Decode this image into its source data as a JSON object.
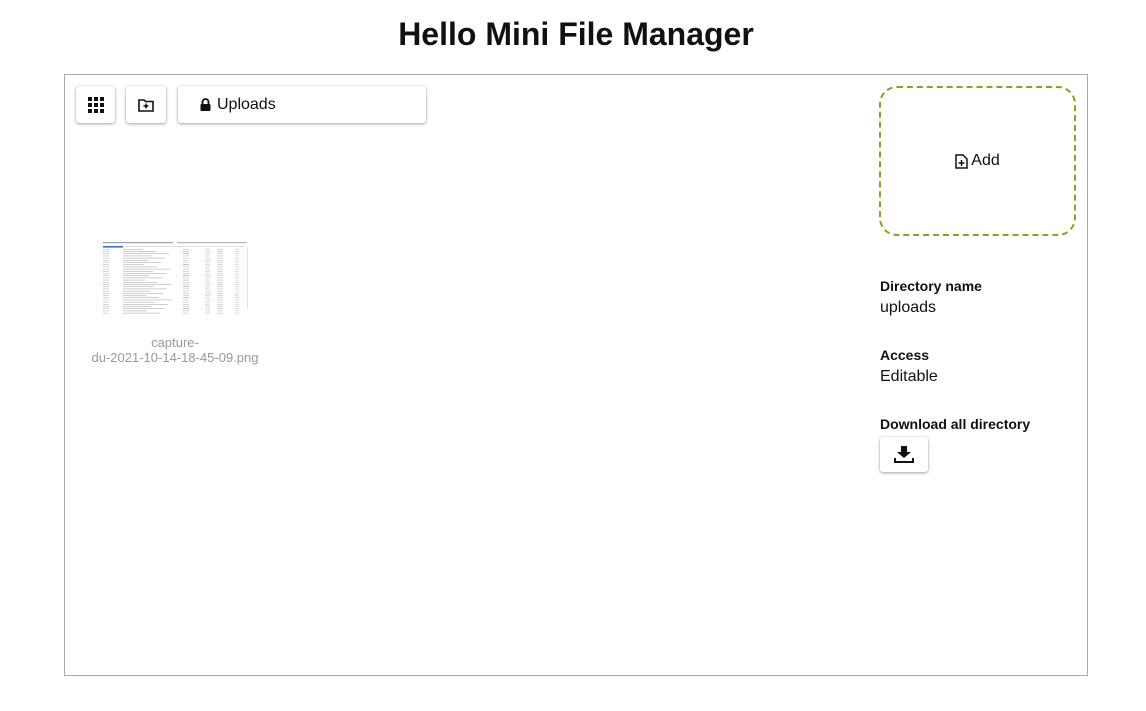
{
  "page": {
    "title": "Hello Mini File Manager"
  },
  "toolbar": {
    "grid_icon": "grid-view-icon",
    "new_folder_icon": "folder-plus-icon",
    "current_dir_label": "Uploads",
    "lock_icon": "lock-icon"
  },
  "files": [
    {
      "name": "capture-\ndu-2021-10-14-18-45-09.png",
      "name_line1": "capture-",
      "name_line2": "du-2021-10-14-18-45-09.png"
    }
  ],
  "dropzone": {
    "label": "Add",
    "icon": "file-plus-icon",
    "border_color": "#9a9a1f"
  },
  "info": {
    "directory_name_label": "Directory name",
    "directory_name_value": "uploads",
    "access_label": "Access",
    "access_value": "Editable",
    "download_label": "Download all directory",
    "download_icon": "download-icon"
  }
}
